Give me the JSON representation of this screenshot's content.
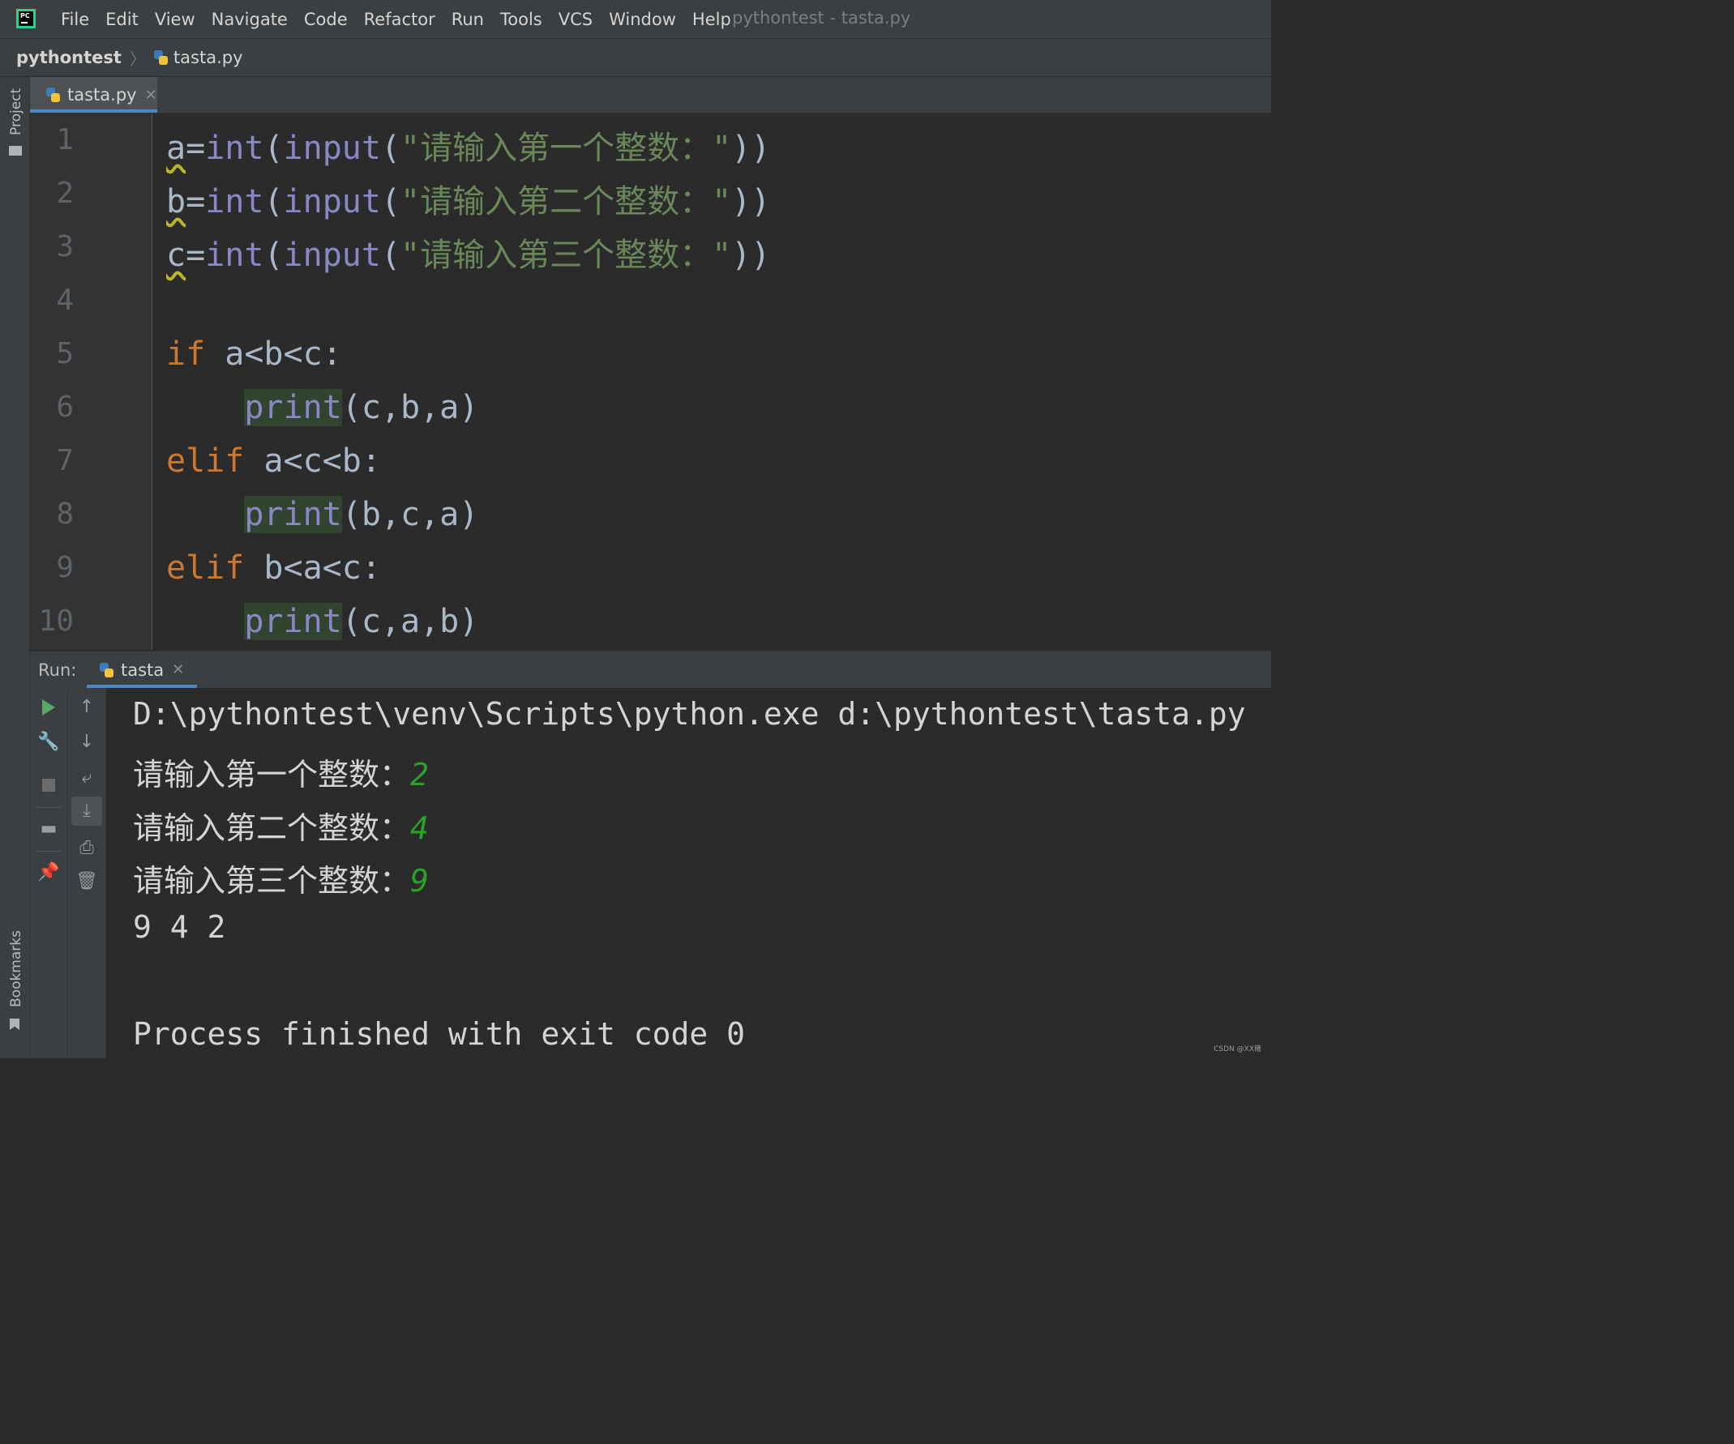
{
  "menubar": {
    "items": [
      "File",
      "Edit",
      "View",
      "Navigate",
      "Code",
      "Refactor",
      "Run",
      "Tools",
      "VCS",
      "Window",
      "Help"
    ],
    "window_title": "pythontest - tasta.py",
    "logo_text": "PC"
  },
  "breadcrumb": {
    "project": "pythontest",
    "file": "tasta.py"
  },
  "left_strip": {
    "project": "Project",
    "bookmarks": "Bookmarks"
  },
  "editor": {
    "tab": "tasta.py",
    "close_glyph": "✕",
    "line_numbers": [
      "1",
      "2",
      "3",
      "4",
      "5",
      "6",
      "7",
      "8",
      "9",
      "10"
    ],
    "code": {
      "l1_var": "a",
      "l1_eq": "=",
      "l1_int": "int",
      "l1_p1": "(",
      "l1_input": "input",
      "l1_p2": "(",
      "l1_str": "\"请输入第一个整数：\"",
      "l1_end": "))",
      "l2_var": "b",
      "l2_eq": "=",
      "l2_int": "int",
      "l2_p1": "(",
      "l2_input": "input",
      "l2_p2": "(",
      "l2_str": "\"请输入第二个整数：\"",
      "l2_end": "))",
      "l3_var": "c",
      "l3_eq": "=",
      "l3_int": "int",
      "l3_p1": "(",
      "l3_input": "input",
      "l3_p2": "(",
      "l3_str": "\"请输入第三个整数：\"",
      "l3_end": "))",
      "l5_kw": "if",
      "l5_cond": " a<b<c:",
      "l6_print": "print",
      "l6_args": "(c,b,a)",
      "l7_kw": "elif",
      "l7_cond": " a<c<b:",
      "l8_print": "print",
      "l8_args": "(b,c,a)",
      "l9_kw": "elif",
      "l9_cond": " b<a<c:",
      "l10_print": "print",
      "l10_args": "(c,a,b)"
    }
  },
  "run": {
    "label": "Run:",
    "tab": "tasta",
    "close_glyph": "✕",
    "console": {
      "cmd": "D:\\pythontest\\venv\\Scripts\\python.exe d:\\pythontest\\tasta.py",
      "p1": "请输入第一个整数：",
      "i1": "2",
      "p2": "请输入第二个整数：",
      "i2": "4",
      "p3": "请输入第三个整数：",
      "i3": "9",
      "out": "9 4 2",
      "exit": "Process finished with exit code 0"
    }
  },
  "watermark": "CSDN @XX雍",
  "icons": {
    "run": "play-icon",
    "settings": "wrench-icon",
    "stop": "stop-icon",
    "layout": "layout-icon",
    "pin": "pin-icon",
    "up": "arrow-up-icon",
    "down": "arrow-down-icon",
    "wrap": "soft-wrap-icon",
    "scroll": "scroll-to-end-icon",
    "print": "print-icon",
    "trash": "trash-icon"
  },
  "colors": {
    "keyword": "#cc7832",
    "builtin": "#8888c6",
    "string": "#6a8759",
    "console_input": "#27a327",
    "accent": "#4a88c7"
  }
}
